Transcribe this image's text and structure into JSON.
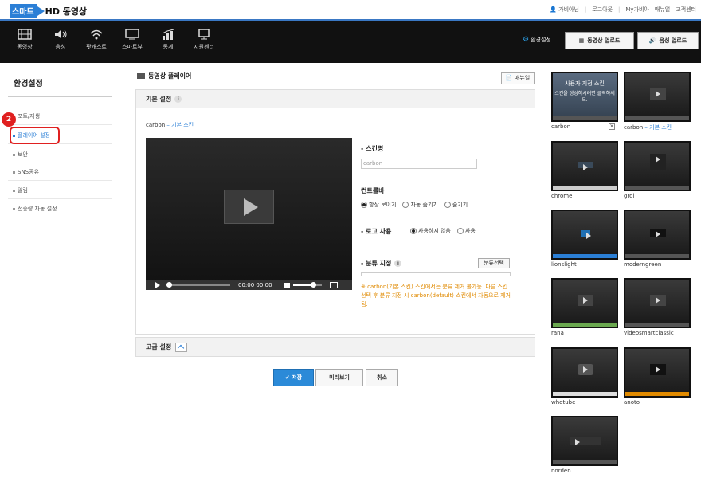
{
  "brand": {
    "smart": "스마트",
    "hd": "HD 동영상"
  },
  "toplinks": [
    "가비아님",
    "로그아웃",
    "My가비아",
    "매뉴얼",
    "고객센터"
  ],
  "nav": [
    {
      "label": "동영상",
      "icon": "film-icon"
    },
    {
      "label": "음성",
      "icon": "speaker-icon"
    },
    {
      "label": "팟캐스트",
      "icon": "wifi-icon"
    },
    {
      "label": "스마트뷰",
      "icon": "monitor-icon"
    },
    {
      "label": "통계",
      "icon": "chart-icon"
    },
    {
      "label": "지원센터",
      "icon": "support-icon"
    }
  ],
  "header_actions": {
    "settings": "환경설정",
    "video_upload": "동영상 업로드",
    "audio_upload": "음성 업로드"
  },
  "sidebar": {
    "title": "환경설정",
    "items": [
      "포트/재생",
      "플레이어 설정",
      "보안",
      "SNS공유",
      "알림",
      "전송량 자동 설정"
    ],
    "badge": "2"
  },
  "content": {
    "title": "동영상 플레이어",
    "manual": "매뉴얼",
    "basic_title": "기본 설정",
    "info": "i",
    "skin_name": "carbon",
    "skin_desc": " – 기본 스킨",
    "player_time": "00:00 00:00",
    "skin_label": "- 스킨명",
    "skin_value": "carbon",
    "controlbar_label": "컨트롤바",
    "controlbar_options": [
      "항상 보이기",
      "자동 숨기기",
      "숨기기"
    ],
    "logo_label": "- 로고 사용",
    "logo_options": [
      "사용하지 않음",
      "사용"
    ],
    "category_label": "- 분류 지정",
    "category_btn": "분류선택",
    "warning": "※ carbon(기본 스킨) 스킨에서는 분류 제거 불가능. 다른 스킨 선택 후 분류 지정 시 carbon(default) 스킨에서 자동으로 제거됨.",
    "advanced_title": "고급 설정",
    "buttons": {
      "save": "저장",
      "preview": "미리보기",
      "cancel": "취소"
    }
  },
  "skins": [
    {
      "name": "carbon",
      "desc": ""
    },
    {
      "name": "carbon",
      "desc": " – 기본 스킨"
    },
    {
      "name": "chrome",
      "desc": ""
    },
    {
      "name": "grol",
      "desc": ""
    },
    {
      "name": "lionslight",
      "desc": ""
    },
    {
      "name": "moderngreen",
      "desc": ""
    },
    {
      "name": "rana",
      "desc": ""
    },
    {
      "name": "videosmartclassic",
      "desc": ""
    },
    {
      "name": "whotube",
      "desc": ""
    },
    {
      "name": "anoto",
      "desc": ""
    },
    {
      "name": "norden",
      "desc": ""
    }
  ],
  "carbon_thumb": {
    "caption": "사용자 지정 스킨",
    "sub": "스킨을 생성하시려면 클릭하세요."
  },
  "colors": {
    "accent": "#2b7fd6",
    "highlight": "#e02020",
    "warning": "#e08a00",
    "nav_bg": "#111111"
  }
}
